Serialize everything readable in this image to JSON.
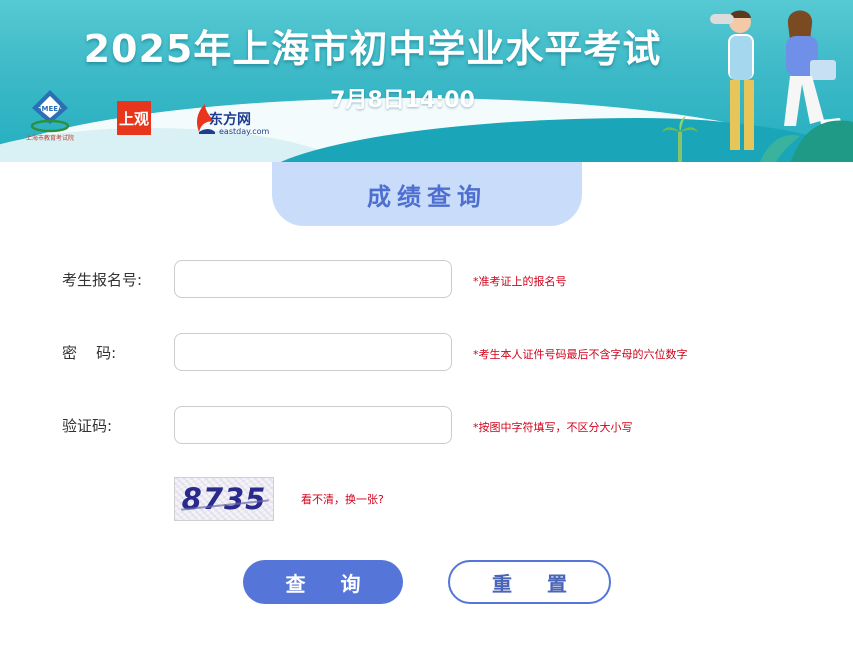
{
  "banner": {
    "title": "2025年上海市初中学业水平考试",
    "date": "7月8日14:00",
    "logos": {
      "smeea_text": "SMEEA",
      "smeea_caption": "上海市教育考试院",
      "shangguan": "上观",
      "eastday_name": "东方网",
      "eastday_url": "eastday.com"
    }
  },
  "header": {
    "title": "成绩查询"
  },
  "form": {
    "reg_no": {
      "label": "考生报名号:",
      "value": "",
      "placeholder": "",
      "hint": "*准考证上的报名号"
    },
    "password": {
      "label": "密    码:",
      "value": "",
      "placeholder": "",
      "hint": "*考生本人证件号码最后不含字母的六位数字"
    },
    "captcha": {
      "label": "验证码:",
      "value": "",
      "placeholder": "",
      "hint": "*按图中字符填写，不区分大小写"
    },
    "captcha_image_text": "8735",
    "refresh_link": "看不清，换一张?"
  },
  "buttons": {
    "query": "查 询",
    "reset": "重 置"
  },
  "colors": {
    "accent": "#5576d8",
    "hint": "#d0021b",
    "banner": "#3db9c7",
    "tab": "#c9dcf9"
  }
}
